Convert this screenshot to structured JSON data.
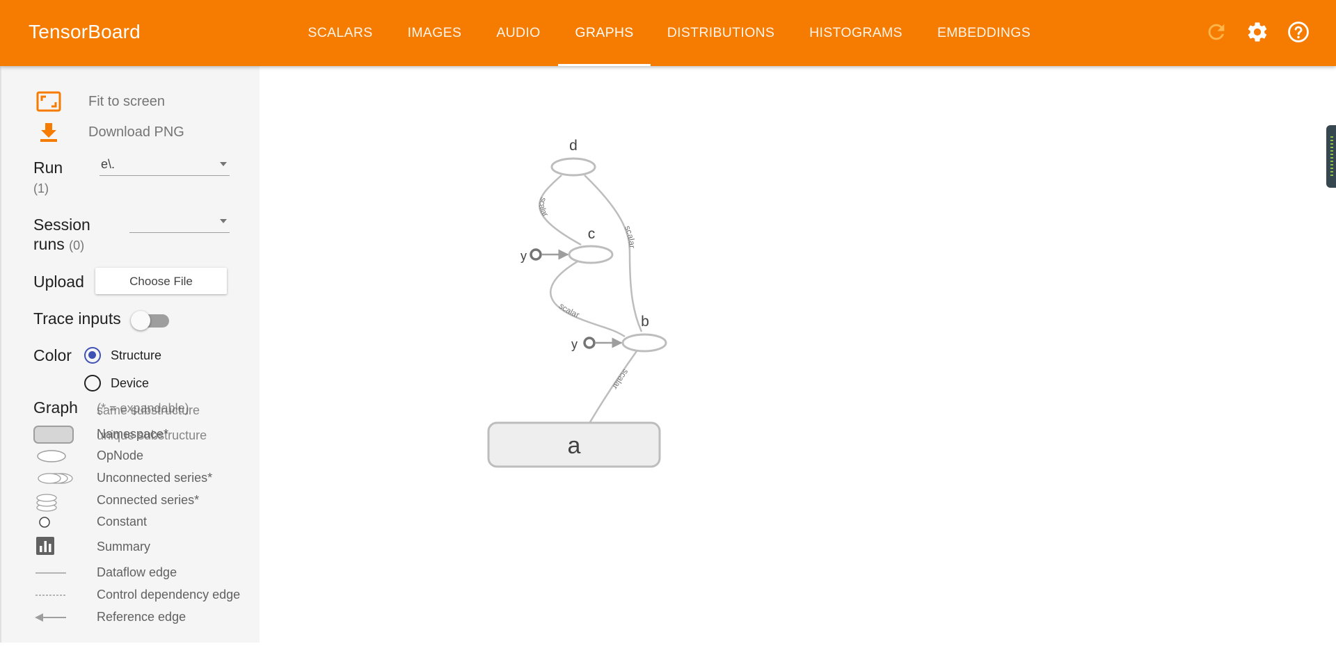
{
  "header": {
    "title": "TensorBoard",
    "tabs": [
      {
        "label": "SCALARS"
      },
      {
        "label": "IMAGES"
      },
      {
        "label": "AUDIO"
      },
      {
        "label": "GRAPHS"
      },
      {
        "label": "DISTRIBUTIONS"
      },
      {
        "label": "HISTOGRAMS"
      },
      {
        "label": "EMBEDDINGS"
      }
    ],
    "active_tab": "GRAPHS",
    "icons": [
      "refresh-icon",
      "settings-icon",
      "help-icon"
    ],
    "accent": "#f57c00"
  },
  "sidebar": {
    "fit_label": "Fit to screen",
    "download_label": "Download PNG",
    "run_label": "Run",
    "run_count": "(1)",
    "run_value": "e\\.",
    "session_label_1": "Session",
    "session_label_2": "runs",
    "session_count": "(0)",
    "session_value": "",
    "upload_label": "Upload",
    "choose_file": "Choose File",
    "trace_label": "Trace inputs",
    "trace_on": false,
    "color_label": "Color",
    "color_options": [
      {
        "label": "Structure",
        "selected": true
      },
      {
        "label": "Device",
        "selected": false
      }
    ],
    "graph_label": "Graph",
    "expandable_note": "(* = expandable)",
    "same_sub": "same substructure",
    "unique_sub": "unique substructure",
    "legend": [
      {
        "icon": "namespace-icon",
        "label": "Namespace*"
      },
      {
        "icon": "opnode-icon",
        "label": "OpNode"
      },
      {
        "icon": "unconnected-series-icon",
        "label": "Unconnected series*"
      },
      {
        "icon": "connected-series-icon",
        "label": "Connected series*"
      },
      {
        "icon": "constant-icon",
        "label": "Constant"
      },
      {
        "icon": "summary-icon",
        "label": "Summary"
      },
      {
        "icon": "dataflow-edge-icon",
        "label": "Dataflow edge"
      },
      {
        "icon": "control-dependency-edge-icon",
        "label": "Control dependency edge"
      },
      {
        "icon": "reference-edge-icon",
        "label": "Reference edge"
      }
    ]
  },
  "graph": {
    "nodes": {
      "d": "d",
      "c": "c",
      "b": "b",
      "a": "a",
      "y1": "y",
      "y2": "y"
    },
    "edge_label": "scalar"
  }
}
